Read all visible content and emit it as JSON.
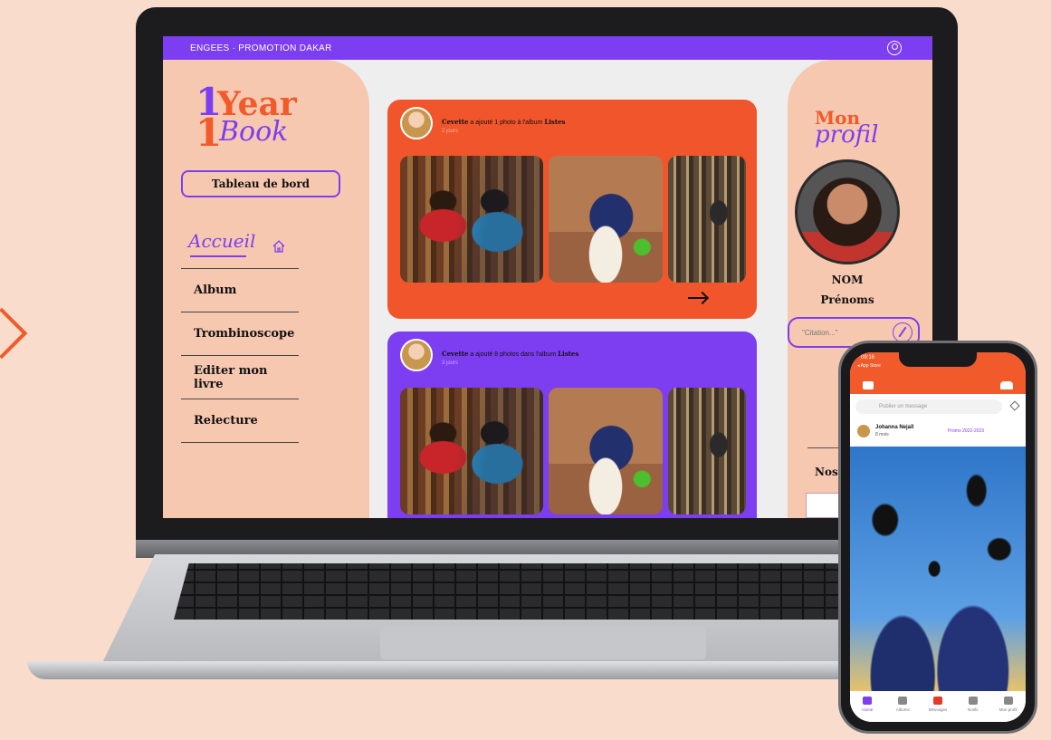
{
  "app": {
    "title": "ENGEES · PROMOTION DAKAR"
  },
  "logo": {
    "line1_num": "1",
    "line1_word": "Year",
    "line2_num": "1",
    "line2_word": "Book"
  },
  "sidebar": {
    "dashboard_label": "Tableau de bord",
    "home_label": "Accueil",
    "items": [
      {
        "label": "Album"
      },
      {
        "label": "Trombinoscope"
      },
      {
        "label": "Editer mon livre"
      },
      {
        "label": "Relecture"
      }
    ]
  },
  "feed": {
    "posts": [
      {
        "author": "Cevette",
        "text": "a ajouté 1 photo à l'album",
        "album": "Listes",
        "time": "2 jours"
      },
      {
        "author": "Cevette",
        "text": "a ajouté 8 photos dans l'album",
        "album": "Listes",
        "time": "3 jours"
      }
    ]
  },
  "profile": {
    "title_a": "Mon",
    "title_b": "profil",
    "last_name": "NOM",
    "first_name": "Prénoms",
    "quote_placeholder": "\"Citation...\"",
    "section": "Nos"
  },
  "phone": {
    "time": "09:16",
    "sub": "◂ App Store",
    "post_placeholder": "Publier un message",
    "post_author": "Johanna Nejaïl",
    "post_ago": "8 mois",
    "promo": "Promo 2022-2023",
    "tabs": [
      {
        "label": "Home"
      },
      {
        "label": "Albums"
      },
      {
        "label": "Messages"
      },
      {
        "label": "Notifs"
      },
      {
        "label": "Mon profil"
      }
    ]
  },
  "colors": {
    "purple": "#7d3df0",
    "orange": "#f15a2b",
    "peach": "#f7c8b0",
    "background": "#f9dccb"
  }
}
